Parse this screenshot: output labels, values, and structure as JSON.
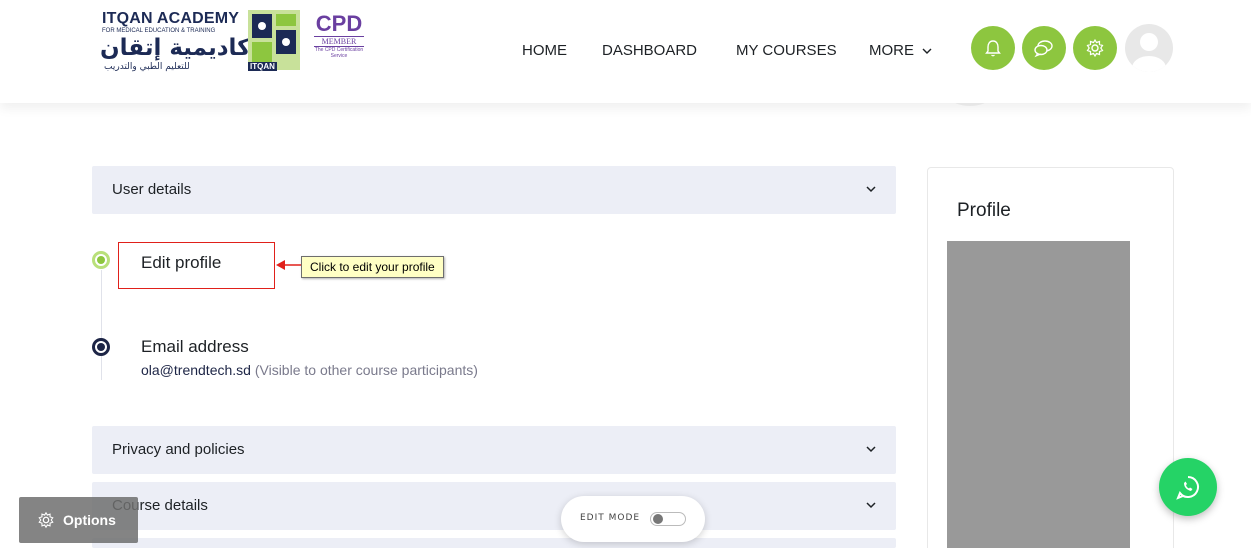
{
  "logo": {
    "english": "ITQAN ACADEMY",
    "subtitle": "FOR MEDICAL EDUCATION & TRAINING",
    "arabic": "أكاديمية إتقان",
    "arabic_sub": "للتعليم الطبي والتدريب",
    "mark_text": "ITQAN",
    "cpd": "CPD",
    "cpd_member": "MEMBER",
    "cpd_service": "The CPD Certification Service"
  },
  "nav": {
    "home": "HOME",
    "dashboard": "DASHBOARD",
    "my_courses": "MY COURSES",
    "more": "MORE"
  },
  "colors": {
    "accent_green": "#8dc63f",
    "panel_bg": "#eceef6",
    "whatsapp": "#25d366",
    "highlight_red": "#e0201a"
  },
  "header_icons": [
    "bell-icon",
    "chat-icon",
    "gear-icon",
    "avatar"
  ],
  "panels": {
    "user_details": "User details",
    "privacy": "Privacy and policies",
    "course_details": "Course details"
  },
  "edit_profile": {
    "label": "Edit profile",
    "callout": "Click to edit your profile"
  },
  "email": {
    "title": "Email address",
    "value": "ola@trendtech.sd",
    "note": "(Visible to other course participants)"
  },
  "sidebar": {
    "title": "Profile"
  },
  "floating": {
    "options": "Options",
    "edit_mode": "EDIT MODE"
  }
}
